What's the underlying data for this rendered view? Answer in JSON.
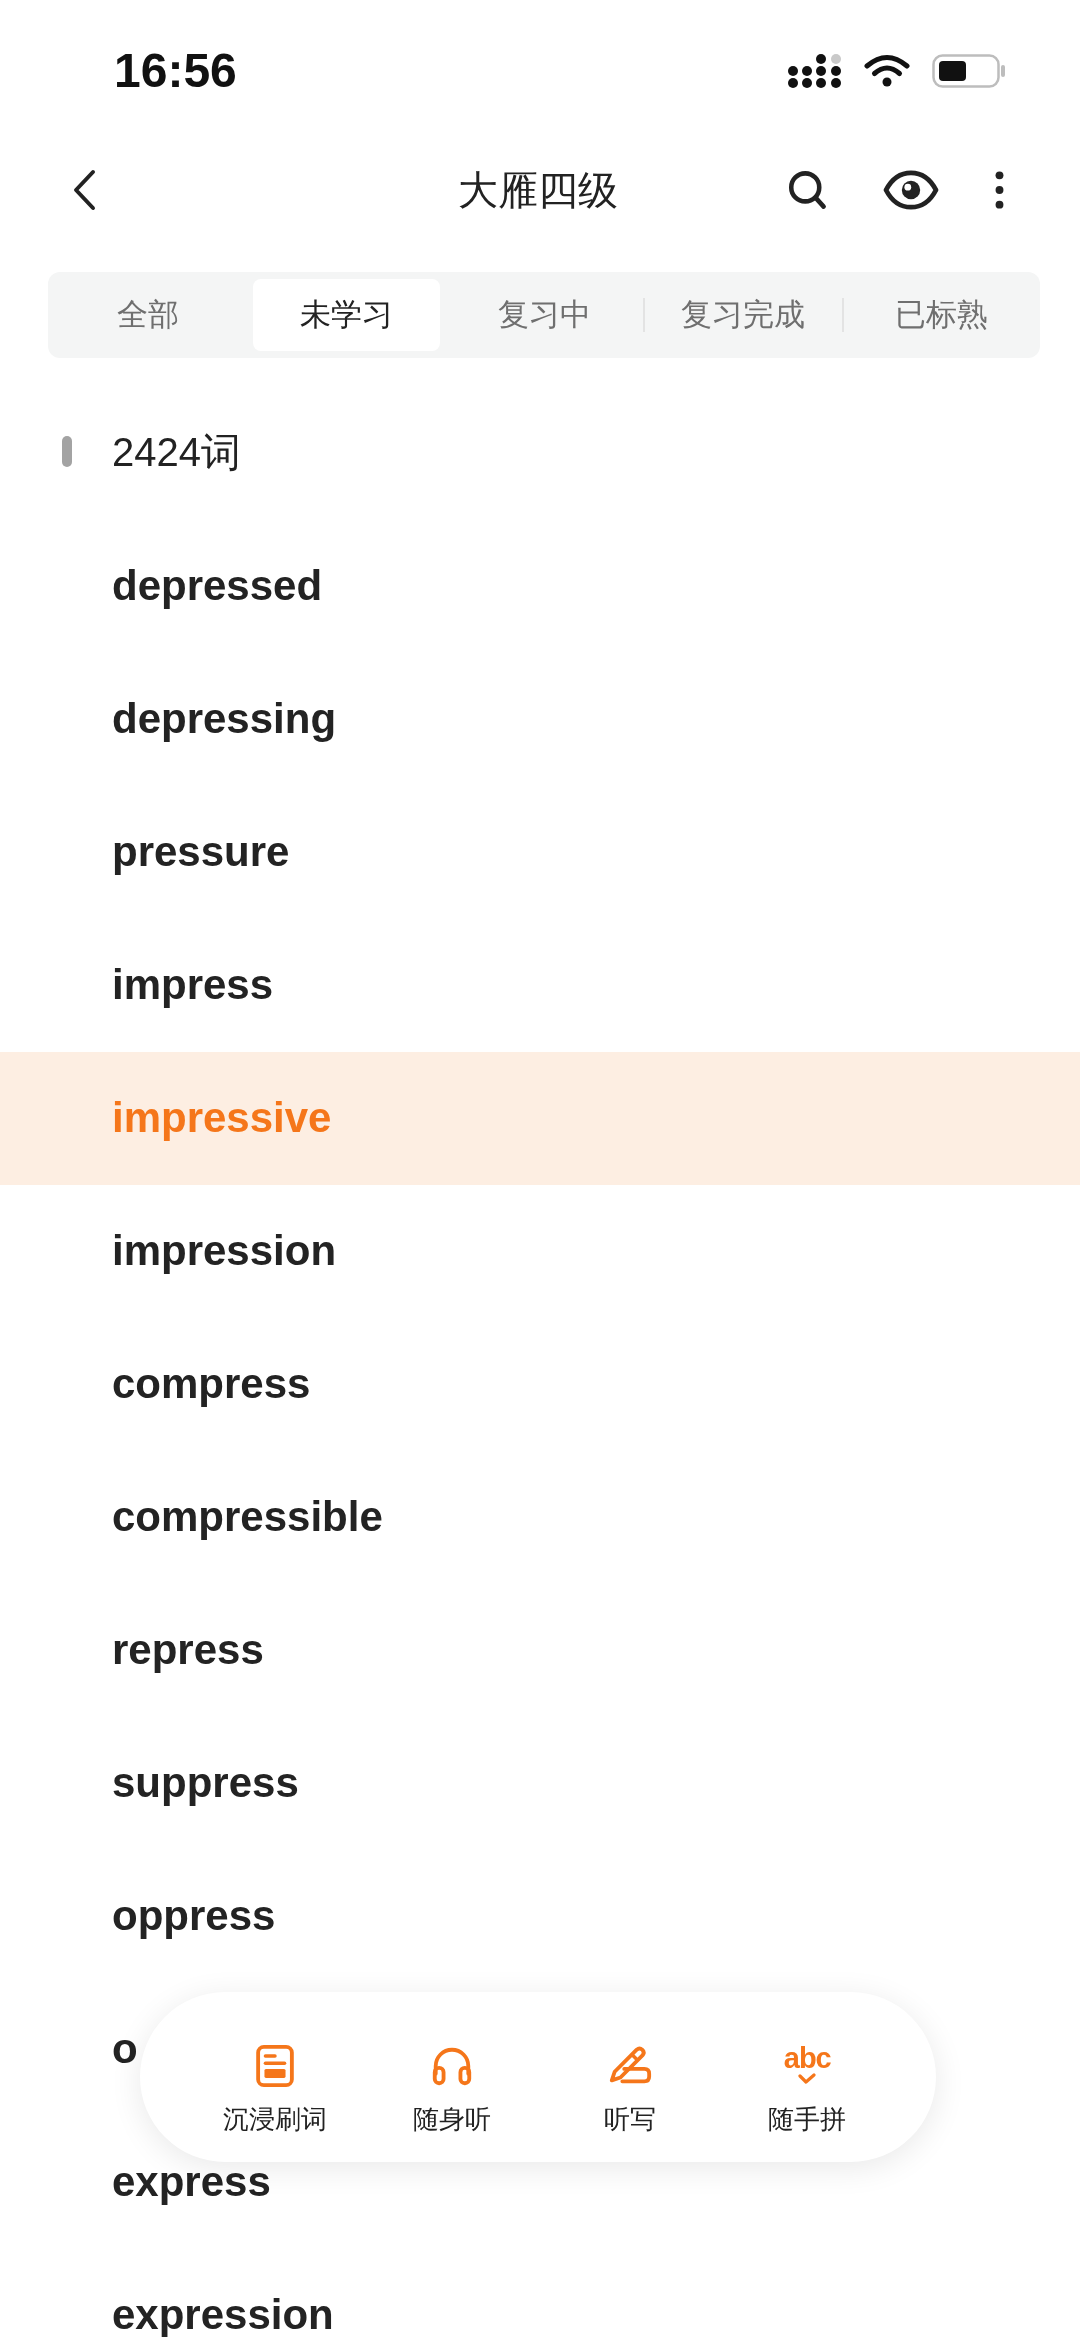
{
  "status_bar": {
    "time": "16:56"
  },
  "header": {
    "title": "大雁四级"
  },
  "tabs": [
    {
      "label": "全部",
      "selected": false
    },
    {
      "label": "未学习",
      "selected": true
    },
    {
      "label": "复习中",
      "selected": false
    },
    {
      "label": "复习完成",
      "selected": false
    },
    {
      "label": "已标熟",
      "selected": false
    }
  ],
  "word_count": "2424词",
  "words": [
    {
      "word": "depressed",
      "selected": false
    },
    {
      "word": "depressing",
      "selected": false
    },
    {
      "word": "pressure",
      "selected": false
    },
    {
      "word": "impress",
      "selected": false
    },
    {
      "word": "impressive",
      "selected": true
    },
    {
      "word": "impression",
      "selected": false
    },
    {
      "word": "compress",
      "selected": false
    },
    {
      "word": "compressible",
      "selected": false
    },
    {
      "word": "repress",
      "selected": false
    },
    {
      "word": "suppress",
      "selected": false
    },
    {
      "word": "oppress",
      "selected": false
    },
    {
      "word": "o",
      "selected": false
    },
    {
      "word": "express",
      "selected": false
    },
    {
      "word": "expression",
      "selected": false
    }
  ],
  "toolbar": [
    {
      "kind": "immersive",
      "label": "沉浸刷词"
    },
    {
      "kind": "listen",
      "label": "随身听"
    },
    {
      "kind": "dictation",
      "label": "听写"
    },
    {
      "kind": "spell",
      "label": "随手拼",
      "icon_text": "abc"
    }
  ]
}
